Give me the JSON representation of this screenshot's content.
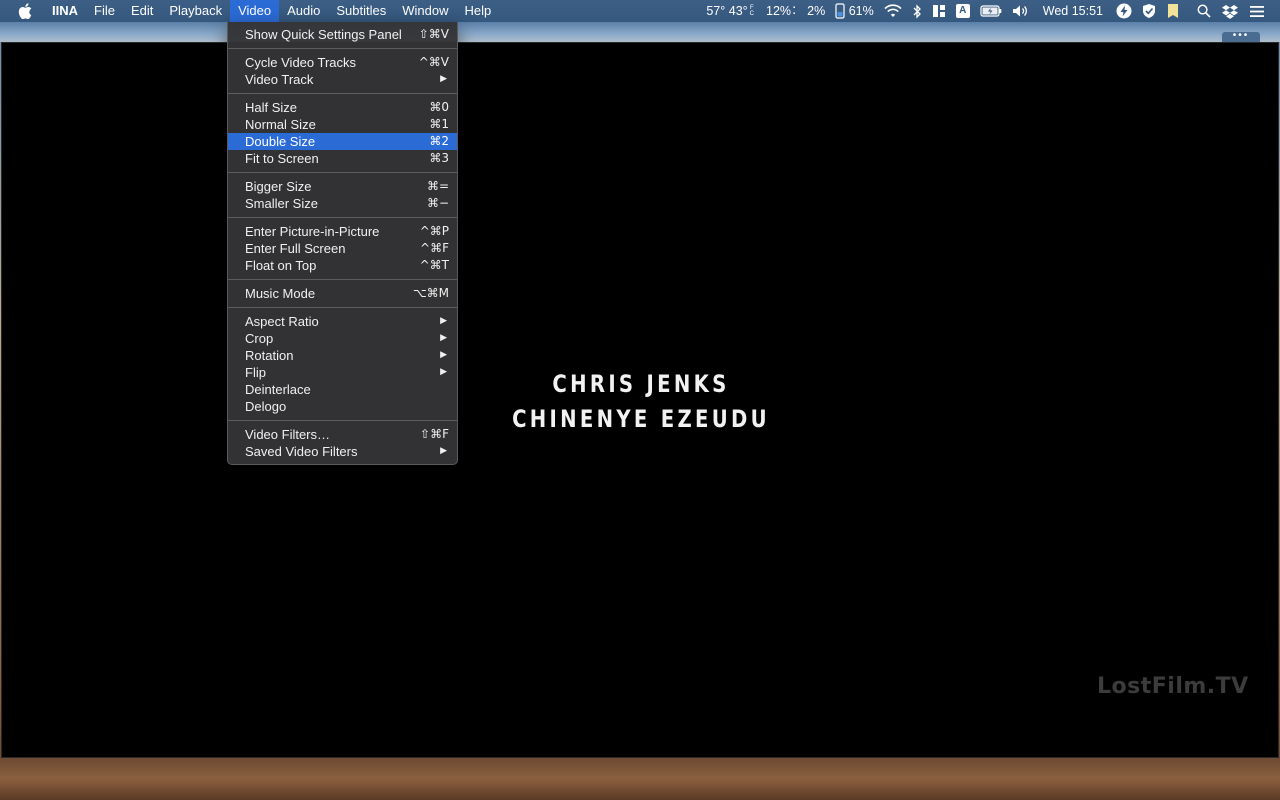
{
  "menubar": {
    "app_name": "IINA",
    "menus": [
      "File",
      "Edit",
      "Playback",
      "Video",
      "Audio",
      "Subtitles",
      "Window",
      "Help"
    ],
    "active_menu": "Video",
    "status": {
      "temp_high": "57°",
      "temp_low": "43°",
      "temp_unit_f": "F",
      "temp_unit_c": "C",
      "cpu": "12%",
      "disk": "2%",
      "battery_small": "61%",
      "clock": "Wed 15:51",
      "input_source": "A"
    }
  },
  "video_menu": {
    "items": [
      {
        "label": "Show Quick Settings Panel",
        "shortcut": "⇧⌘V"
      },
      {
        "separator": true
      },
      {
        "label": "Cycle Video Tracks",
        "shortcut": "^⌘V"
      },
      {
        "label": "Video Track",
        "submenu": true
      },
      {
        "separator": true
      },
      {
        "label": "Half Size",
        "shortcut": "⌘0"
      },
      {
        "label": "Normal Size",
        "shortcut": "⌘1"
      },
      {
        "label": "Double Size",
        "shortcut": "⌘2",
        "highlighted": true
      },
      {
        "label": "Fit to Screen",
        "shortcut": "⌘3"
      },
      {
        "separator": true
      },
      {
        "label": "Bigger Size",
        "shortcut": "⌘="
      },
      {
        "label": "Smaller Size",
        "shortcut": "⌘−"
      },
      {
        "separator": true
      },
      {
        "label": "Enter Picture-in-Picture",
        "shortcut": "^⌘P"
      },
      {
        "label": "Enter Full Screen",
        "shortcut": "^⌘F"
      },
      {
        "label": "Float on Top",
        "shortcut": "^⌘T"
      },
      {
        "separator": true
      },
      {
        "label": "Music Mode",
        "shortcut": "⌥⌘M"
      },
      {
        "separator": true
      },
      {
        "label": "Aspect Ratio",
        "submenu": true
      },
      {
        "label": "Crop",
        "submenu": true
      },
      {
        "label": "Rotation",
        "submenu": true
      },
      {
        "label": "Flip",
        "submenu": true
      },
      {
        "label": "Deinterlace"
      },
      {
        "label": "Delogo"
      },
      {
        "separator": true
      },
      {
        "label": "Video Filters…",
        "shortcut": "⇧⌘F"
      },
      {
        "label": "Saved Video Filters",
        "submenu": true
      }
    ]
  },
  "video": {
    "credit_line_1": "CHRIS JENKS",
    "credit_line_2": "CHINENYE EZEUDU",
    "watermark": "LostFilm.TV"
  },
  "icons": [
    "apple-icon",
    "cpu-icon",
    "battery-icon",
    "lightning-icon",
    "wifi-icon",
    "bluetooth-icon",
    "window-tiling-icon",
    "input-source-icon",
    "battery-charging-icon",
    "volume-icon",
    "shield-icon",
    "badge-icon",
    "search-icon",
    "dropbox-icon",
    "list-icon",
    "more-icon"
  ]
}
